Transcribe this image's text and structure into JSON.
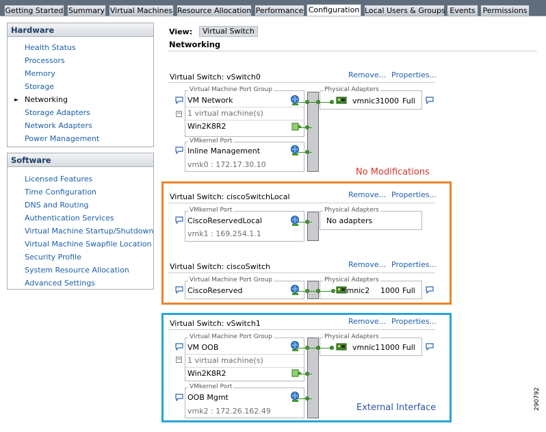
{
  "tabs": [
    {
      "label": "Getting Started",
      "active": false
    },
    {
      "label": "Summary",
      "active": false
    },
    {
      "label": "Virtual Machines",
      "active": false
    },
    {
      "label": "Resource Allocation",
      "active": false
    },
    {
      "label": "Performance",
      "active": false
    },
    {
      "label": "Configuration",
      "active": true
    },
    {
      "label": "Local Users & Groups",
      "active": false
    },
    {
      "label": "Events",
      "active": false
    },
    {
      "label": "Permissions",
      "active": false
    }
  ],
  "hardware": {
    "header": "Hardware",
    "items": [
      "Health Status",
      "Processors",
      "Memory",
      "Storage",
      "Networking",
      "Storage Adapters",
      "Network Adapters",
      "Power Management"
    ],
    "selected": "Networking"
  },
  "software": {
    "header": "Software",
    "items": [
      "Licensed Features",
      "Time Configuration",
      "DNS and Routing",
      "Authentication Services",
      "Virtual Machine Startup/Shutdown",
      "Virtual Machine Swapfile Location",
      "Security Profile",
      "System Resource Allocation",
      "Advanced Settings"
    ]
  },
  "view": {
    "label": "View:",
    "value": "Virtual Switch"
  },
  "section_title": "Networking",
  "links": {
    "remove": "Remove...",
    "properties": "Properties..."
  },
  "labels": {
    "vm_port_group": "Virtual Machine Port Group",
    "vmkernel_port": "VMkernel Port",
    "physical_adapters": "Physical Adapters"
  },
  "switches": {
    "vswitch0": {
      "title": "Virtual Switch: vSwitch0",
      "pg_name": "VM Network",
      "vm_count": "1 virtual machine(s)",
      "vm_name": "Win2K8R2",
      "vmk_name": "Inline Management",
      "vmk_ip": "vmk0 : 172.17.30.10",
      "adapter": {
        "name": "vmnic3",
        "speed": "1000",
        "duplex": "Full"
      }
    },
    "local": {
      "title": "Virtual Switch: ciscoSwitchLocal",
      "vmk_name": "CiscoReservedLocal",
      "vmk_ip": "vmk1 : 169.254.1.1",
      "no_adapters": "No adapters"
    },
    "cisco": {
      "title": "Virtual Switch: ciscoSwitch",
      "pg_name": "CiscoReserved",
      "adapter": {
        "name": "vmnic2",
        "speed": "1000",
        "duplex": "Full"
      }
    },
    "vswitch1": {
      "title": "Virtual Switch: vSwitch1",
      "pg_name": "VM OOB",
      "vm_count": "1 virtual machine(s)",
      "vm_name": "Win2K8R2",
      "vmk_name": "OOB Mgmt",
      "vmk_ip": "vmk2 : 172.26.162.49",
      "adapter": {
        "name": "vmnic1",
        "speed": "1000",
        "duplex": "Full"
      }
    }
  },
  "annotations": {
    "no_mod": {
      "text": "No Modifications",
      "color": "#e8822b",
      "text_color": "#d9342b"
    },
    "external": {
      "text": "External Interface",
      "color": "#27a3d8",
      "text_color": "#2a54a4"
    }
  },
  "figure_id": "290792",
  "colors": {
    "link": "#1c5ea8",
    "tabbar": "#5f6d7c",
    "wire": "#3d8e2a"
  }
}
